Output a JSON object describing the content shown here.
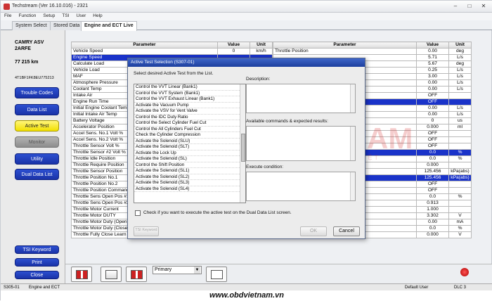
{
  "window": {
    "title": "Techstream (Ver 16.10.016) - 2321",
    "min": "–",
    "max": "□",
    "close": "✕"
  },
  "menu": [
    "File",
    "Function",
    "Setup",
    "TSI",
    "User",
    "Help"
  ],
  "tabs": [
    "System Select",
    "Stored Data",
    "Engine and ECT Live"
  ],
  "vehicle": {
    "model": "CAMRY ASV",
    "engine": "2ARFE",
    "odometer": "77 215 km",
    "vin": "4T1BF1FK8EU775213"
  },
  "left_buttons": [
    "Trouble Codes",
    "Data List",
    "Active Test",
    "Monitor",
    "Utility",
    "Dual Data List"
  ],
  "left_bottom_buttons": [
    "TSI Keyword",
    "Print",
    "Close"
  ],
  "table_headers": {
    "param": "Parameter",
    "value": "Value",
    "unit": "Unit"
  },
  "left_table": [
    {
      "p": "Vehicle Speed",
      "v": "0",
      "u": "km/h"
    },
    {
      "p": "Engine Speed",
      "v": "",
      "u": "",
      "sel": true
    },
    {
      "p": "Calculate Load",
      "v": "",
      "u": ""
    },
    {
      "p": "Vehicle Load",
      "v": "",
      "u": ""
    },
    {
      "p": "MAF",
      "v": "",
      "u": ""
    },
    {
      "p": "Atmosphere Pressure",
      "v": "",
      "u": ""
    },
    {
      "p": "Coolant Temp",
      "v": "",
      "u": ""
    },
    {
      "p": "Intake Air",
      "v": "",
      "u": ""
    },
    {
      "p": "Engine Run Time",
      "v": "",
      "u": ""
    },
    {
      "p": "Initial Engine Coolant Temp",
      "v": "",
      "u": ""
    },
    {
      "p": "Initial Intake Air Temp",
      "v": "",
      "u": ""
    },
    {
      "p": "Battery Voltage",
      "v": "",
      "u": ""
    },
    {
      "p": "Accelerator Position",
      "v": "",
      "u": ""
    },
    {
      "p": "Accel Sens. No.1 Volt %",
      "v": "",
      "u": ""
    },
    {
      "p": "Accel Sens. No.2 Volt %",
      "v": "",
      "u": ""
    },
    {
      "p": "Throttle Sensor Volt %",
      "v": "",
      "u": ""
    },
    {
      "p": "Throttle Sensor #2 Volt %",
      "v": "",
      "u": ""
    },
    {
      "p": "Throttle Idle Position",
      "v": "",
      "u": ""
    },
    {
      "p": "Throttle Require Position",
      "v": "",
      "u": ""
    },
    {
      "p": "Throttle Sensor Position",
      "v": "",
      "u": ""
    },
    {
      "p": "Throttle Position No.1",
      "v": "",
      "u": ""
    },
    {
      "p": "Throttle Position No.2",
      "v": "",
      "u": ""
    },
    {
      "p": "Throttle Position Command",
      "v": "",
      "u": ""
    },
    {
      "p": "Throttle Sens Open Pos #1",
      "v": "",
      "u": ""
    },
    {
      "p": "Throttle Sens Open Pos #2",
      "v": "",
      "u": ""
    },
    {
      "p": "Throttle Motor Current",
      "v": "",
      "u": ""
    },
    {
      "p": "Throttle Motor DUTY",
      "v": "",
      "u": ""
    },
    {
      "p": "Throttle Motor Duty (Open)",
      "v": "",
      "u": ""
    },
    {
      "p": "Throttle Motor Duty (Close)",
      "v": "",
      "u": ""
    },
    {
      "p": "Throttle Fully Close Learn",
      "v": "0.644",
      "u": "V"
    }
  ],
  "right_table": [
    {
      "p": "Throttle Position",
      "v": "0.00",
      "u": "deg"
    },
    {
      "p": "",
      "v": "5.71",
      "u": "L/s"
    },
    {
      "p": "",
      "v": "5.67",
      "u": "deg"
    },
    {
      "p": "",
      "v": "0.25",
      "u": "L/s"
    },
    {
      "p": "",
      "v": "3.00",
      "u": "L/s"
    },
    {
      "p": "",
      "v": "0.00",
      "u": "L/s"
    },
    {
      "p": "",
      "v": "0.00",
      "u": "L/s"
    },
    {
      "p": "",
      "v": "OFF",
      "u": ""
    },
    {
      "p": "",
      "v": "OFF",
      "u": "",
      "sel": true
    },
    {
      "p": "",
      "v": "0.00",
      "u": "L/s"
    },
    {
      "p": "",
      "v": "0.00",
      "u": "L/s"
    },
    {
      "p": "",
      "v": "0",
      "u": "us"
    },
    {
      "p": "",
      "v": "0.000",
      "u": "ml"
    },
    {
      "p": "",
      "v": "OFF",
      "u": ""
    },
    {
      "p": "",
      "v": "OFF",
      "u": ""
    },
    {
      "p": "",
      "v": "OFF",
      "u": ""
    },
    {
      "p": "",
      "v": "0.0",
      "u": "%",
      "sel": true
    },
    {
      "p": "",
      "v": "0.0",
      "u": "%"
    },
    {
      "p": "",
      "v": "0.000",
      "u": ""
    },
    {
      "p": "",
      "v": "125.456",
      "u": "kPa(abs)"
    },
    {
      "p": "",
      "v": "125.456",
      "u": "kPa(abs)",
      "sel": true
    },
    {
      "p": "",
      "v": "OFF",
      "u": ""
    },
    {
      "p": "",
      "v": "OFF",
      "u": ""
    },
    {
      "p": "",
      "v": "0.0",
      "u": "%"
    },
    {
      "p": "",
      "v": "0.913",
      "u": ""
    },
    {
      "p": "",
      "v": "1.000",
      "u": ""
    },
    {
      "p": "",
      "v": "3.302",
      "u": "V"
    },
    {
      "p": "",
      "v": "0.00",
      "u": "mA"
    },
    {
      "p": "",
      "v": "0.0",
      "u": "%"
    },
    {
      "p": "O2S B1S2",
      "v": "0.000",
      "u": "V"
    }
  ],
  "dialog": {
    "title": "Active Test Selection (S307-01)",
    "select_label": "Select desired Active Test from the List.",
    "description_label": "Description:",
    "commands_label": "Available commands & expected results:",
    "execute_label": "Execute condition:",
    "tests": [
      "Control the VVT Linear (Bank1)",
      "Control the VVT System (Bank1)",
      "Control the VVT Exhaust Linear (Bank1)",
      "Activate the Vacuum Pump",
      "Activate the VSV for Vent Valve",
      "Control the IDC Duty Ratio",
      "Control the Select Cylinder Fuel Cut",
      "Control the All Cylinders Fuel Cut",
      "Check the Cylinder Compression",
      "Activate the Solenoid (SLU)",
      "Activate the Solenoid (SLT)",
      "Activate the Lock Up",
      "Activate the Solenoid (SL)",
      "Control the Shift Position",
      "Activate the Solenoid (SL1)",
      "Activate the Solenoid (SL2)",
      "Activate the Solenoid (SL3)",
      "Activate the Solenoid (SL4)"
    ],
    "dual_check_label": "Check if you want to execute the active test on the Dual Data List screen.",
    "tsi_button": "TSI Keyword",
    "ok_button": "OK",
    "cancel_button": "Cancel"
  },
  "toolbar": {
    "primary_select": "Primary"
  },
  "status": {
    "left": "S305-01",
    "mid": "Engine and ECT",
    "user": "Default User",
    "dlc": "DLC 3"
  },
  "watermark": {
    "brand": "OBDVIETNAM",
    "slogan": "ĐỒNG HÀNH CÙNG GARA VIỆT",
    "url": "www.obdvietnam.vn"
  },
  "colors": {
    "selected_row": "#1a33c9",
    "button_blue": "#1f3db8",
    "active_yellow": "#f5e600",
    "watermark_red": "#d62020"
  }
}
